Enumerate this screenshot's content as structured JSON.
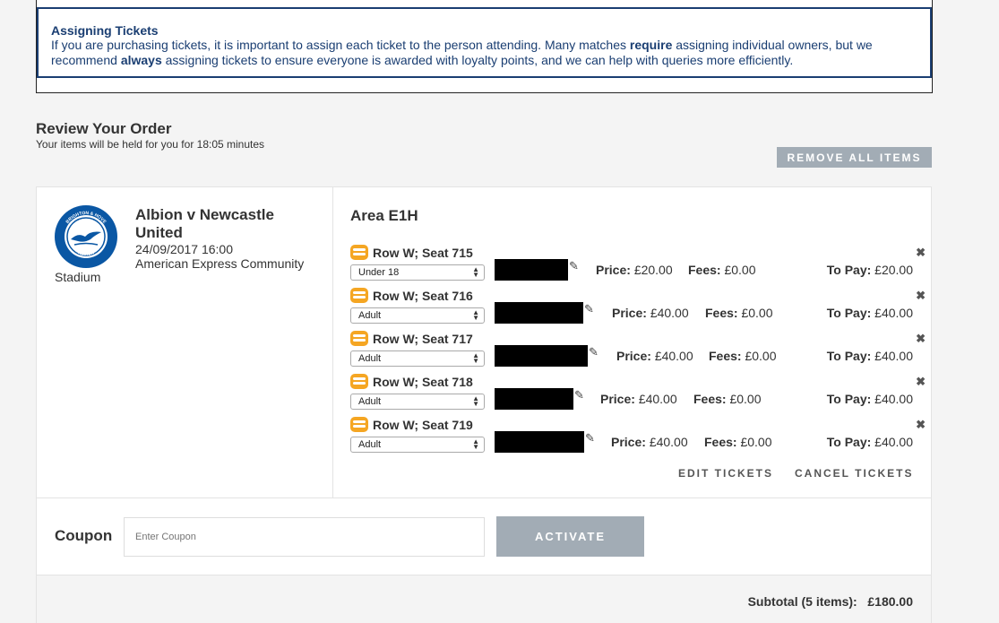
{
  "notice": {
    "title": "Assigning Tickets",
    "text_1": "If you are purchasing tickets, it is important to assign each ticket to the person attending. Many matches ",
    "strong_1": "require",
    "text_2": " assigning individual owners, but we recommend ",
    "strong_2": "always",
    "text_3": " assigning tickets to ensure everyone is awarded with loyalty points, and we can help with queries more efficiently."
  },
  "review": {
    "title": "Review Your Order",
    "subtitle": "Your items will be held for you for 18:05 minutes",
    "remove_all_label": "REMOVE ALL ITEMS"
  },
  "match": {
    "title": "Albion v Newcastle United",
    "datetime": "24/09/2017 16:00",
    "venue": "American Express Community",
    "venue_tail": "Stadium",
    "logo_text_top": "BRIGHTON & HOVE",
    "logo_text_bottom": "ALBION"
  },
  "area": {
    "title": "Area E1H"
  },
  "tickets": [
    {
      "seat": "Row W; Seat 715",
      "type": "Under 18",
      "price_label": "Price:",
      "price": "£20.00",
      "fees_label": "Fees:",
      "fees": "£0.00",
      "topay_label": "To Pay:",
      "topay": "£20.00"
    },
    {
      "seat": "Row W; Seat 716",
      "type": "Adult",
      "price_label": "Price:",
      "price": "£40.00",
      "fees_label": "Fees:",
      "fees": "£0.00",
      "topay_label": "To Pay:",
      "topay": "£40.00"
    },
    {
      "seat": "Row W; Seat 717",
      "type": "Adult",
      "price_label": "Price:",
      "price": "£40.00",
      "fees_label": "Fees:",
      "fees": "£0.00",
      "topay_label": "To Pay:",
      "topay": "£40.00"
    },
    {
      "seat": "Row W; Seat 718",
      "type": "Adult",
      "price_label": "Price:",
      "price": "£40.00",
      "fees_label": "Fees:",
      "fees": "£0.00",
      "topay_label": "To Pay:",
      "topay": "£40.00"
    },
    {
      "seat": "Row W; Seat 719",
      "type": "Adult",
      "price_label": "Price:",
      "price": "£40.00",
      "fees_label": "Fees:",
      "fees": "£0.00",
      "topay_label": "To Pay:",
      "topay": "£40.00"
    }
  ],
  "actions": {
    "edit_tickets": "EDIT TICKETS",
    "cancel_tickets": "CANCEL TICKETS"
  },
  "coupon": {
    "label": "Coupon",
    "placeholder": "Enter Coupon",
    "activate_label": "ACTIVATE"
  },
  "summary": {
    "subtotal_label": "Subtotal (5 items):",
    "subtotal_value": "£180.00"
  },
  "colors": {
    "notice_blue": "#1a3e72",
    "button_grey": "#a2acb5",
    "seat_icon_yellow": "#f5a623",
    "logo_blue": "#0a57a4"
  }
}
